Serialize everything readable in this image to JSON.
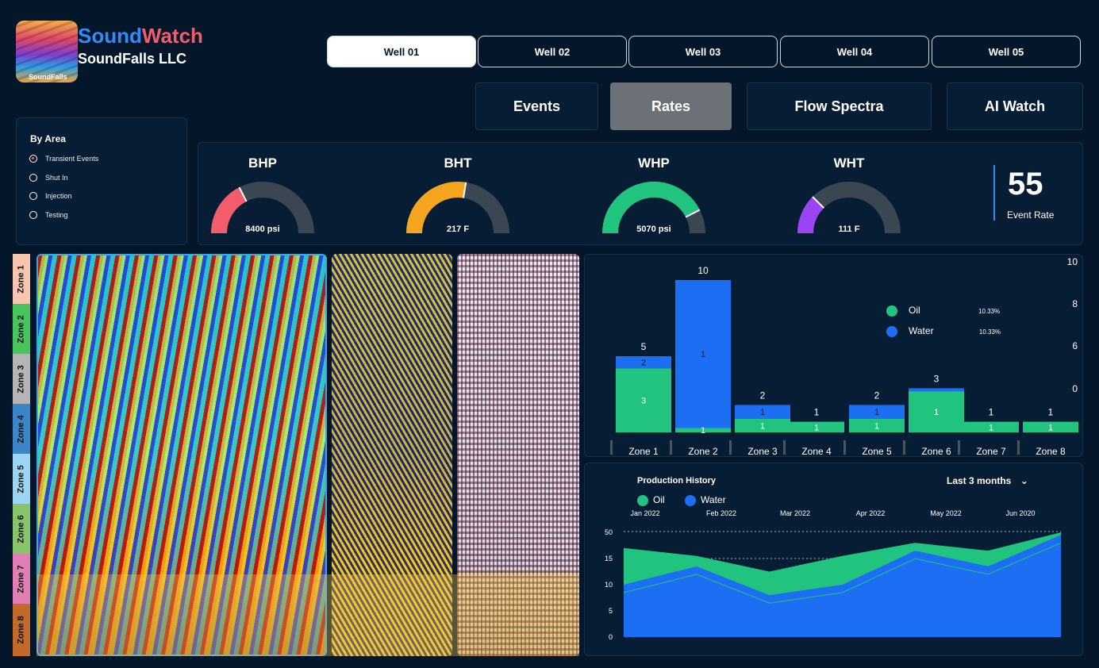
{
  "brand": {
    "logo_text": "SoundFalls",
    "name_part1": "Sound",
    "name_part2": "Watch",
    "company": "SoundFalls LLC"
  },
  "wells": [
    "Well 01",
    "Well 02",
    "Well 03",
    "Well 04",
    "Well 05"
  ],
  "active_well": "Well 01",
  "main_tabs": [
    "Events",
    "Rates",
    "Flow Spectra",
    "AI Watch"
  ],
  "active_tab": "Rates",
  "area_filter": {
    "title": "By Area",
    "options": [
      "Transient Events",
      "Shut In",
      "Injection",
      "Testing"
    ],
    "selected": "Transient Events"
  },
  "gauges": [
    {
      "title": "BHP",
      "value": "8400 psi",
      "fill": 0.35,
      "color": "#f25d6c"
    },
    {
      "title": "BHT",
      "value": "217 F",
      "fill": 0.55,
      "color": "#f5a51e"
    },
    {
      "title": "WHP",
      "value": "5070 psi",
      "fill": 0.85,
      "color": "#21c47f"
    },
    {
      "title": "WHT",
      "value": "111 F",
      "fill": 0.25,
      "color": "#9b45f5"
    }
  ],
  "event_rate": {
    "value": "55",
    "label": "Event Rate"
  },
  "zones": [
    {
      "label": "Zone 1",
      "color": "#f7c6b0"
    },
    {
      "label": "Zone 2",
      "color": "#48c45c"
    },
    {
      "label": "Zone 3",
      "color": "#b5b5b5"
    },
    {
      "label": "Zone 4",
      "color": "#3b86c8"
    },
    {
      "label": "Zone 5",
      "color": "#9ad6f4"
    },
    {
      "label": "Zone 6",
      "color": "#88c46a"
    },
    {
      "label": "Zone 7",
      "color": "#e17fb5"
    },
    {
      "label": "Zone 8",
      "color": "#c36a2a"
    }
  ],
  "colors": {
    "oil": "#21c47f",
    "water": "#1c6ff2",
    "accent": "#2f8cff"
  },
  "chart_data": [
    {
      "type": "bar",
      "categories": [
        "Zone 1",
        "Zone 2",
        "Zone 3",
        "Zone 4",
        "Zone 5",
        "Zone 6",
        "Zone 7",
        "Zone 8"
      ],
      "series": [
        {
          "name": "Oil",
          "values": [
            3,
            1,
            1,
            1,
            1,
            1,
            1,
            1
          ]
        },
        {
          "name": "Water",
          "values": [
            2,
            1,
            1,
            0,
            1,
            0,
            0,
            0
          ]
        }
      ],
      "bar_value_labels": [
        3,
        1,
        1,
        1,
        1,
        1,
        1,
        1
      ],
      "bar_value_labels_water": [
        "2",
        "1",
        "1",
        "",
        "1",
        "",
        "",
        ""
      ],
      "totals": [
        5,
        10,
        2,
        1,
        2,
        3,
        1,
        1
      ],
      "bar_heights": [
        5,
        10,
        1.8,
        0.7,
        1.8,
        2.9,
        0.7,
        0.7
      ],
      "oil_share": [
        4.2,
        0.3,
        0.9,
        0.7,
        0.9,
        2.7,
        0.7,
        0.7
      ],
      "y_ticks": [
        "10",
        "8",
        "6",
        "0"
      ],
      "ylim": [
        0,
        10
      ],
      "legend": [
        {
          "name": "Oil",
          "pct": "10.33%"
        },
        {
          "name": "Water",
          "pct": "10.33%"
        }
      ]
    },
    {
      "type": "area",
      "title": "Production History",
      "range_label": "Last 3 months",
      "x": [
        "Jan 2022",
        "Feb 2022",
        "Mar 2022",
        "Apr 2022",
        "May 2022",
        "Jun 2020"
      ],
      "y_ticks": [
        "50",
        "15",
        "10",
        "5",
        "0"
      ],
      "series": [
        {
          "name": "Oil",
          "values": [
            3.4,
            3.1,
            2.5,
            3.1,
            3.6,
            3.3,
            4.0
          ]
        },
        {
          "name": "Water",
          "values": [
            2.0,
            2.7,
            1.6,
            2.0,
            3.3,
            2.7,
            3.9
          ]
        }
      ],
      "legend": [
        "Oil",
        "Water"
      ]
    }
  ]
}
